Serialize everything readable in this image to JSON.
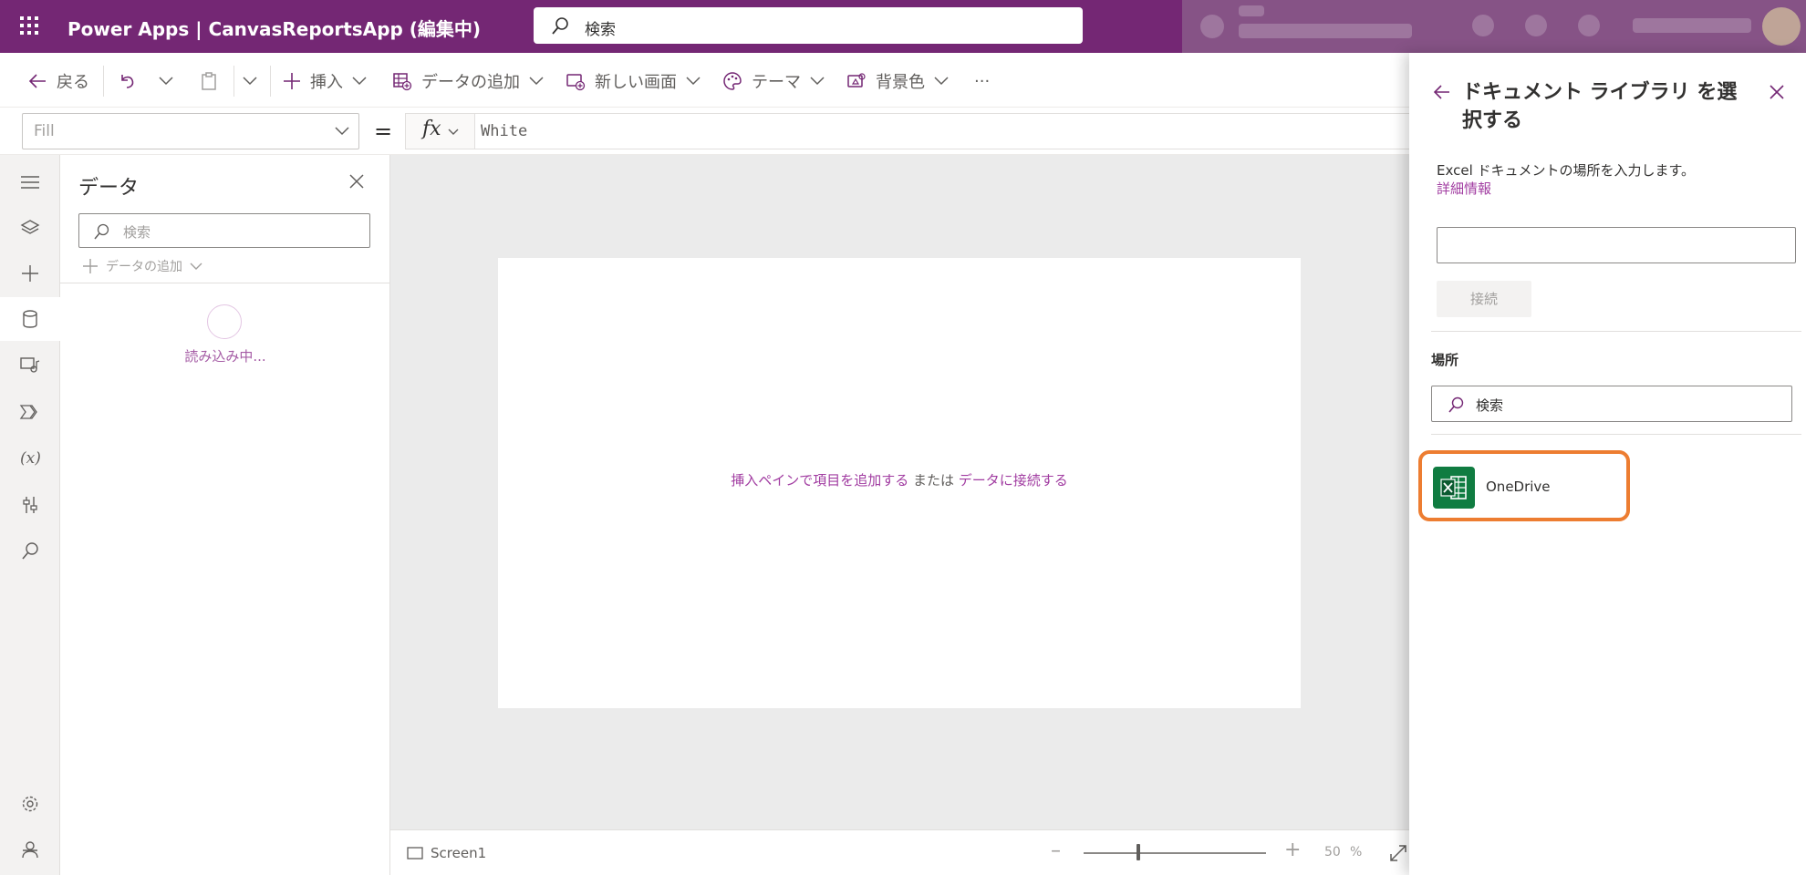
{
  "colors": {
    "brand": "#742774",
    "accent_link": "#a13ca1",
    "highlight_outline": "#ed7d31",
    "excel_green": "#107c41"
  },
  "header": {
    "app_title": "Power Apps  |  CanvasReportsApp (編集中)",
    "search_placeholder": "検索",
    "icons": [
      "waffle-icon",
      "search-icon"
    ]
  },
  "toolbar": {
    "back_label": "戻る",
    "insert_label": "挿入",
    "add_data_label": "データの追加",
    "new_screen_label": "新しい画面",
    "theme_label": "テーマ",
    "background_label": "背景色",
    "more_label": "···"
  },
  "formula_bar": {
    "property": "Fill",
    "equals": "=",
    "fx": "fx",
    "formula": "White"
  },
  "left_rail": {
    "icons": [
      "hamburger-icon",
      "layers-icon",
      "plus-icon",
      "database-icon",
      "media-icon",
      "power-automate-icon",
      "variables-icon",
      "tools-icon",
      "search-icon",
      "settings-icon",
      "virtual-agent-icon"
    ],
    "active": "database-icon"
  },
  "data_pane": {
    "title": "データ",
    "search_placeholder": "検索",
    "add_data_label": "データの追加",
    "loading_text": "読み込み中..."
  },
  "canvas": {
    "hint_link1": "挿入ペインで項目を追加する",
    "hint_middle": " または ",
    "hint_link2": "データに接続する"
  },
  "status_bar": {
    "screen_name": "Screen1",
    "zoom_value": "50",
    "zoom_unit": "%",
    "zoom_level": 0.3
  },
  "flyout": {
    "title": "ドキュメント ライブラリ を選択する",
    "description": "Excel ドキュメントの場所を入力します。",
    "learn_more": "詳細情報",
    "url_value": "",
    "connect_label": "接続",
    "section_label": "場所",
    "search_value": "検索",
    "locations": [
      {
        "label": "OneDrive",
        "icon": "excel-icon"
      }
    ]
  }
}
